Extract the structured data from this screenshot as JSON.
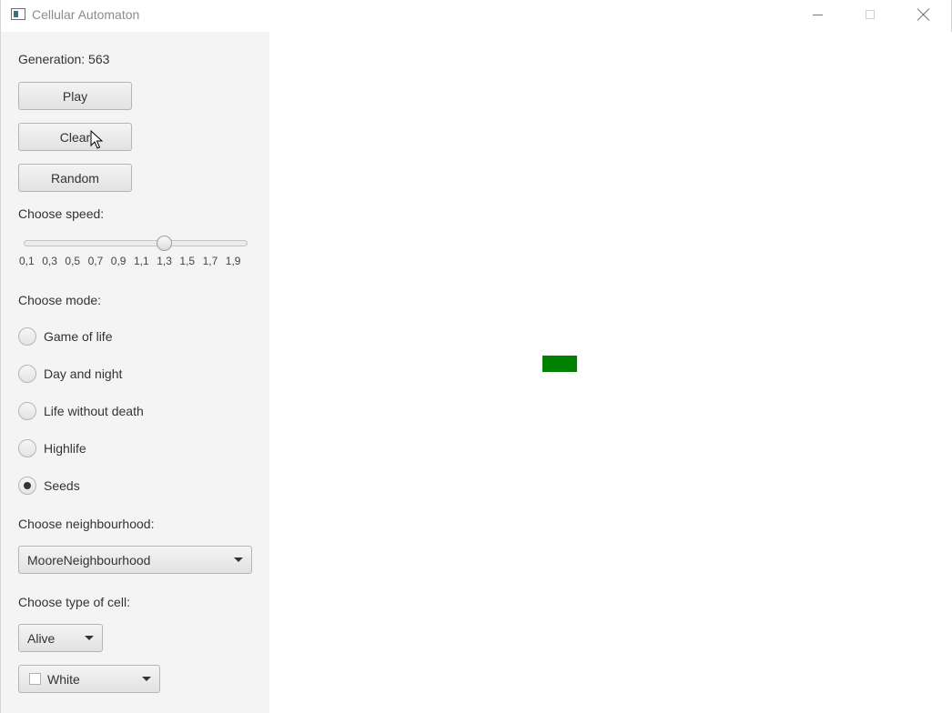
{
  "window": {
    "title": "Cellular Automaton"
  },
  "controls": {
    "generation_label": "Generation: 563",
    "play_label": "Play",
    "clear_label": "Clear",
    "random_label": "Random"
  },
  "speed": {
    "label": "Choose speed:",
    "ticks": [
      "0,1",
      "0,3",
      "0,5",
      "0,7",
      "0,9",
      "1,1",
      "1,3",
      "1,5",
      "1,7",
      "1,9"
    ],
    "value": 1.3
  },
  "mode": {
    "label": "Choose mode:",
    "options": [
      "Game of life",
      "Day and night",
      "Life without death",
      "Highlife",
      "Seeds"
    ],
    "selected": "Seeds"
  },
  "neighbourhood": {
    "label": "Choose neighbourhood:",
    "selected": "MooreNeighbourhood"
  },
  "cell_type": {
    "label": "Choose type of cell:",
    "state_selected": "Alive",
    "color_selected": "White",
    "swatch_color": "#ffffff"
  },
  "grid": {
    "live_cell_color": "#008000"
  }
}
